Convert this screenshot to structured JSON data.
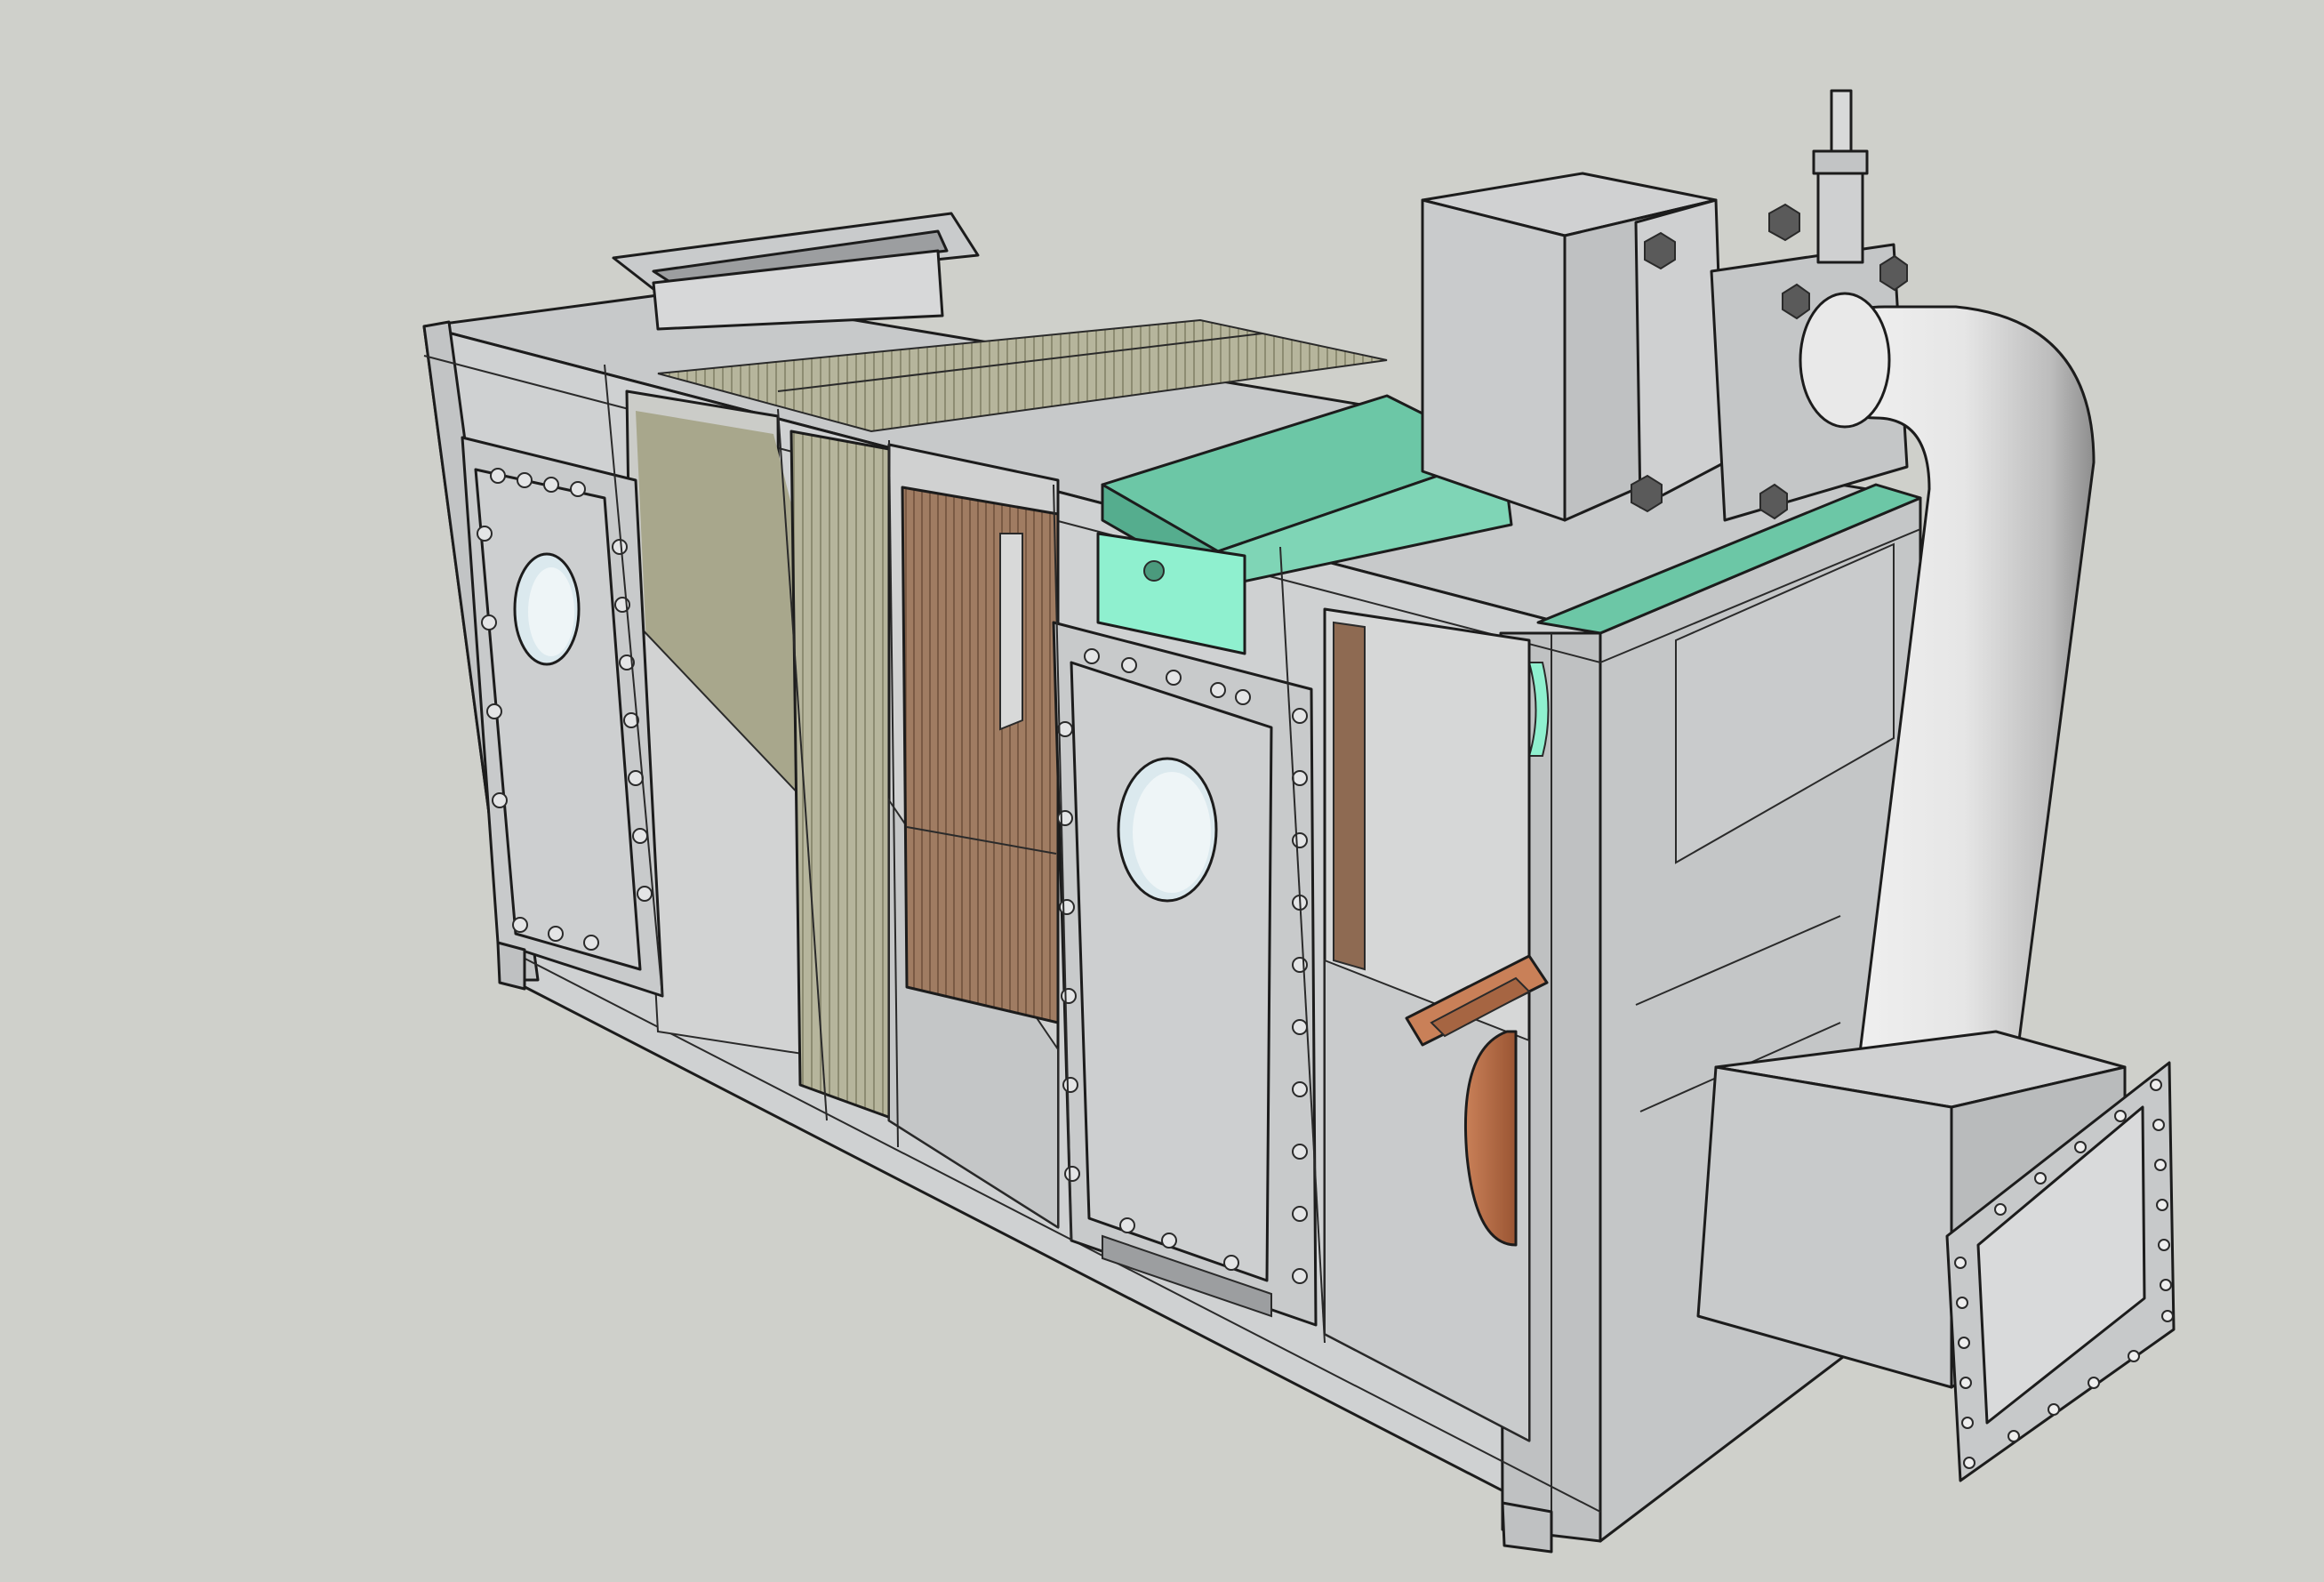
{
  "scene": {
    "background": "#cfd0cb",
    "subject": "air-handling-unit-3d-model",
    "colors": {
      "steel": "#c9cbcc",
      "steel_light": "#e2e3e4",
      "steel_dark": "#9c9ea0",
      "coil_green": "#6cc7a6",
      "coil_green_bright": "#8ff0cf",
      "copper": "#b06a45",
      "filter_olive": "#a8a78c",
      "glass": "#dbe9ee",
      "outline": "#1c1c1c"
    },
    "icons": [
      "porthole-window-icon",
      "bolt-icon",
      "flange-icon",
      "elbow-pipe-icon",
      "fan-wheel-icon"
    ]
  }
}
